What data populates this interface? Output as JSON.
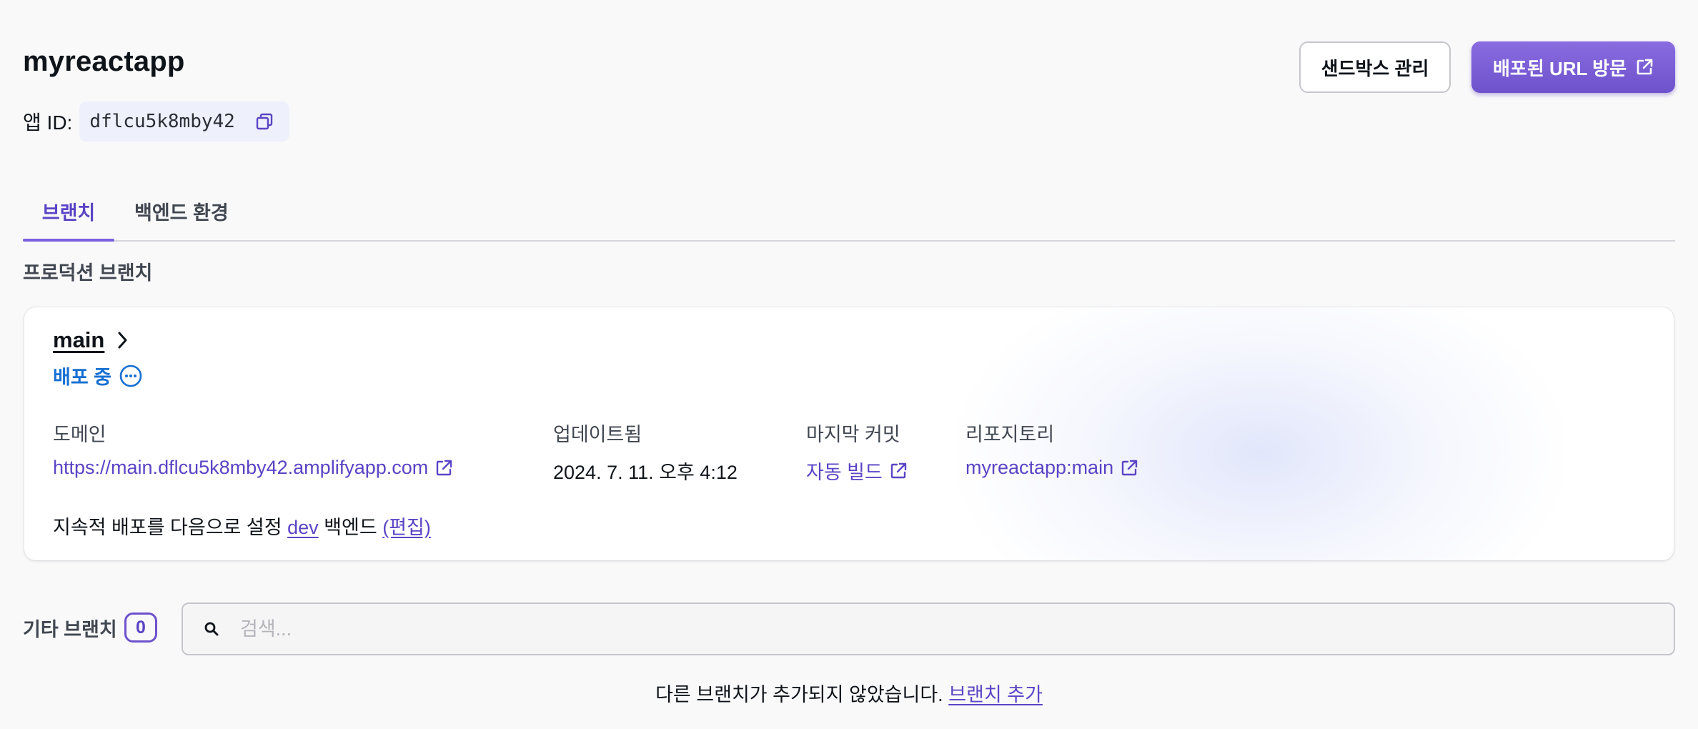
{
  "app": {
    "title": "myreactapp",
    "app_id_label": "앱 ID:",
    "app_id_value": "dflcu5k8mby42"
  },
  "header": {
    "sandbox_button": "샌드박스 관리",
    "visit_button": "배포된 URL 방문"
  },
  "tabs": [
    {
      "label": "브랜치",
      "active": true
    },
    {
      "label": "백엔드 환경",
      "active": false
    }
  ],
  "production": {
    "section_title": "프로덕션 브랜치",
    "branch_name": "main",
    "status": "배포 중",
    "fields": {
      "domain_label": "도메인",
      "domain_value": "https://main.dflcu5k8mby42.amplifyapp.com",
      "updated_label": "업데이트됨",
      "updated_value": "2024. 7. 11. 오후 4:12",
      "commit_label": "마지막 커밋",
      "commit_value": "자동 빌드",
      "repo_label": "리포지토리",
      "repo_value": "myreactapp:main"
    },
    "continuous_deploy": {
      "prefix": "지속적 배포를 다음으로 설정",
      "env": "dev",
      "suffix": "백엔드",
      "edit": "(편집)"
    }
  },
  "other_branches": {
    "label": "기타 브랜치",
    "count": "0",
    "search_placeholder": "검색...",
    "empty_text": "다른 브랜치가 추가되지 않았습니다.",
    "add_link": "브랜치 추가"
  },
  "colors": {
    "accent": "#6e52cc",
    "link": "#5b44c5",
    "status_blue": "#1670d2"
  }
}
